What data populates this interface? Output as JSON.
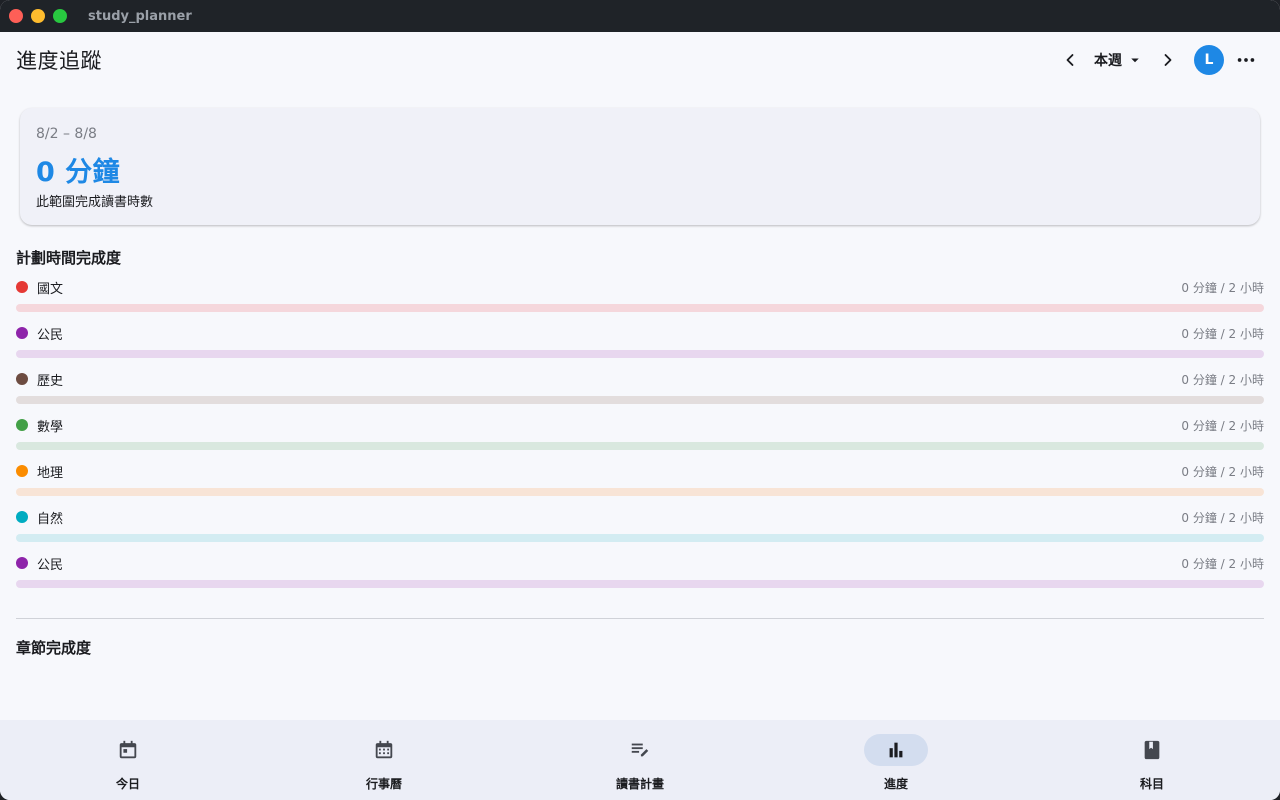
{
  "window": {
    "title": "study_planner"
  },
  "appbar": {
    "title": "進度追蹤",
    "range_label": "本週",
    "avatar_initial": "L"
  },
  "summary": {
    "range": "8/2 – 8/8",
    "value": "0 分鐘",
    "caption": "此範圍完成讀書時數"
  },
  "plan_section": {
    "title": "計劃時間完成度",
    "items": [
      {
        "name": "國文",
        "label": "0 分鐘 / 2 小時",
        "color": "#e53935",
        "track": "#f5d7dc",
        "progress": 0
      },
      {
        "name": "公民",
        "label": "0 分鐘 / 2 小時",
        "color": "#8e24aa",
        "track": "#e8d7ef",
        "progress": 0
      },
      {
        "name": "歷史",
        "label": "0 分鐘 / 2 小時",
        "color": "#6d4c41",
        "track": "#e3dddd",
        "progress": 0
      },
      {
        "name": "數學",
        "label": "0 分鐘 / 2 小時",
        "color": "#43a047",
        "track": "#d9e8df",
        "progress": 0
      },
      {
        "name": "地理",
        "label": "0 分鐘 / 2 小時",
        "color": "#fb8c00",
        "track": "#f8e4d6",
        "progress": 0
      },
      {
        "name": "自然",
        "label": "0 分鐘 / 2 小時",
        "color": "#00acc1",
        "track": "#d3ecf2",
        "progress": 0
      },
      {
        "name": "公民",
        "label": "0 分鐘 / 2 小時",
        "color": "#8e24aa",
        "track": "#e8d7ef",
        "progress": 0
      }
    ]
  },
  "chapter_section": {
    "title": "章節完成度"
  },
  "bottom_nav": {
    "items": [
      {
        "label": "今日",
        "icon": "calendar-today-icon",
        "active": false
      },
      {
        "label": "行事曆",
        "icon": "calendar-month-icon",
        "active": false
      },
      {
        "label": "讀書計畫",
        "icon": "edit-note-icon",
        "active": false
      },
      {
        "label": "進度",
        "icon": "bar-chart-icon",
        "active": true
      },
      {
        "label": "科目",
        "icon": "book-icon",
        "active": false
      }
    ]
  }
}
